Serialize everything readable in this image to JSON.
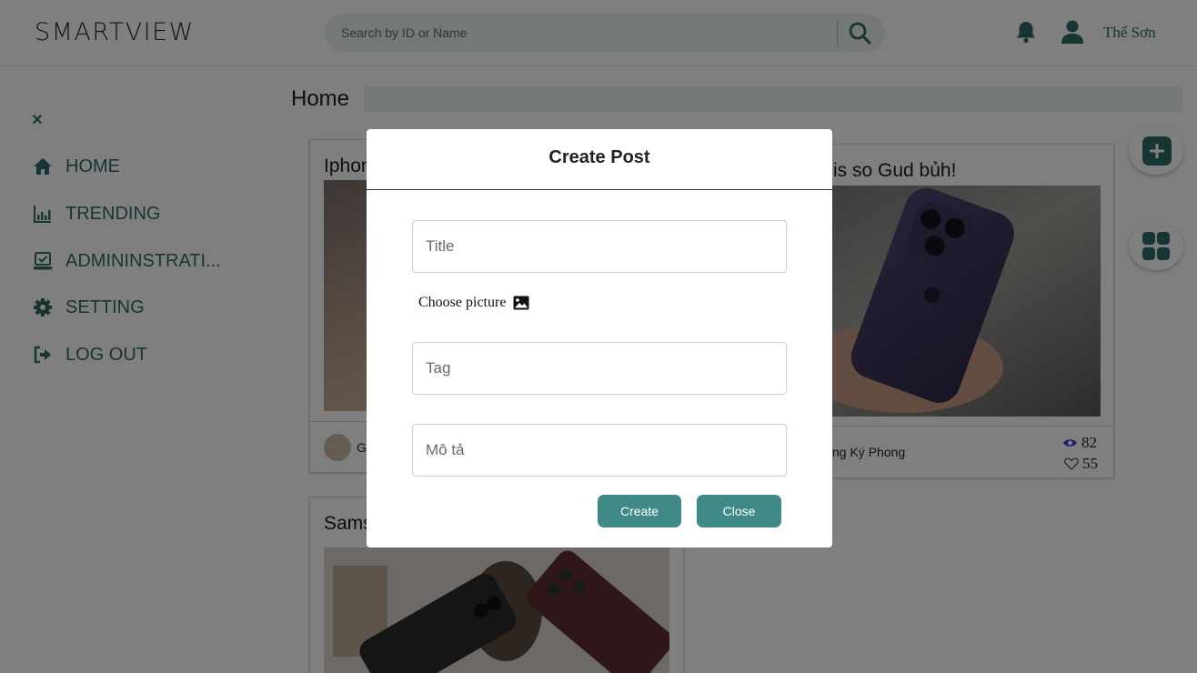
{
  "header": {
    "logo": "SMARTVIEW",
    "search_placeholder": "Search by ID or Name",
    "username": "Thế Sơn"
  },
  "sidebar": {
    "close_label": "×",
    "items": [
      {
        "label": "HOME",
        "icon": "home-icon"
      },
      {
        "label": "TRENDING",
        "icon": "chart-icon"
      },
      {
        "label": "ADMININSTRATI...",
        "icon": "admin-icon"
      },
      {
        "label": "SETTING",
        "icon": "gear-icon"
      },
      {
        "label": "LOG OUT",
        "icon": "logout-icon"
      }
    ]
  },
  "main": {
    "page_title": "Home",
    "cards": [
      {
        "title": "Iphon",
        "author": "G"
      },
      {
        "title": "is so Gud bủh!",
        "author": "ng Ký Phong",
        "views": "82",
        "likes": "55"
      },
      {
        "title": "Sams"
      }
    ]
  },
  "modal": {
    "title": "Create Post",
    "title_placeholder": "Title",
    "choose_picture_label": "Choose picture",
    "tag_placeholder": "Tag",
    "description_placeholder": "Mô tả",
    "create_label": "Create",
    "close_label": "Close"
  },
  "colors": {
    "accent": "#2d6b67",
    "button": "#3f8a86",
    "search_bg": "#e9f0ef"
  }
}
